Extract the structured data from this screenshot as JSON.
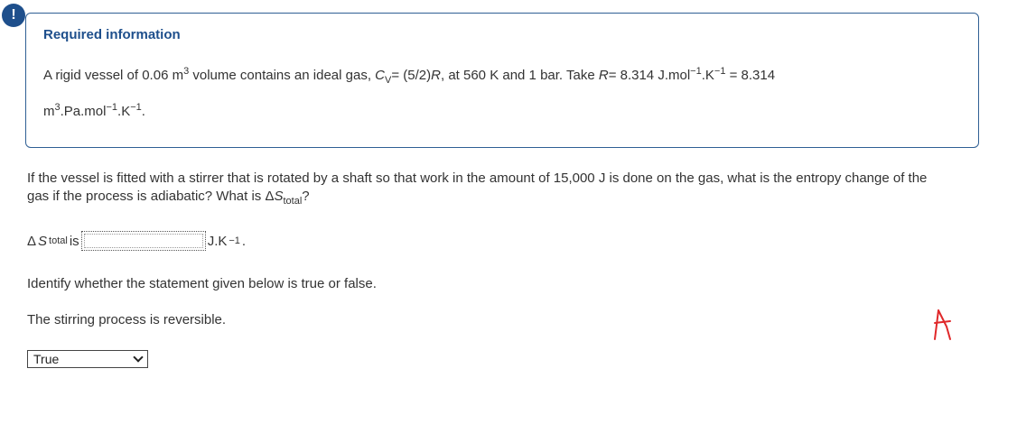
{
  "alert": {
    "glyph": "!"
  },
  "info": {
    "title": "Required information",
    "line1_prefix": "A rigid vessel of 0.06 m",
    "exp_3": "3",
    "line1_mid": " volume contains an ideal gas, ",
    "cv_c": "C",
    "cv_v": "V",
    "line1_cv_value": "= (5/2)",
    "R_var": "R",
    "line1_after_R": ", at 560 K and 1 bar. Take ",
    "line1_equals": "= 8.314 J.mol",
    "exp_neg1": "−1",
    "k_unit": ".K",
    "line1_end": " = 8.314",
    "line2_m": "m",
    "line2_pa": ".Pa.mol",
    "line2_end": "."
  },
  "question": {
    "text": "If the vessel is fitted with a stirrer that is rotated by a shaft so that work in the amount of 15,000 J is done on the gas, what is the entropy change of the gas if the process is adiabatic? What is Δ",
    "s_var": "S",
    "sub_total": "total",
    "end": "?"
  },
  "answer": {
    "delta": "Δ",
    "s_var": "S",
    "sub_total": "total",
    "is_label": " is",
    "input_value": "",
    "unit": "J.K",
    "unit_exp": "−1",
    "unit_end": "."
  },
  "identify_text": "Identify whether the statement given below is true or false.",
  "statement_text": "The stirring process is reversible.",
  "select": {
    "selected": "True",
    "icon": "chevron-down-icon"
  },
  "colors": {
    "accent": "#1e4f8c",
    "border": "#2f5f94",
    "text": "#333333",
    "mark": "#e0282a"
  }
}
